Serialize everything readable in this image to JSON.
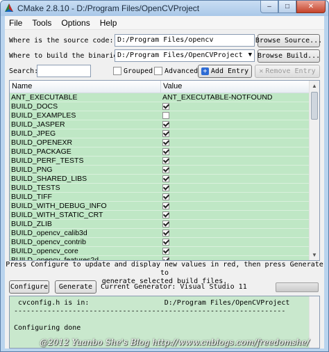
{
  "window": {
    "title": "CMake 2.8.10 - D:/Program Files/OpenCVProject",
    "controls": {
      "minimize": "–",
      "maximize": "□",
      "close": "✕"
    }
  },
  "menu": [
    "File",
    "Tools",
    "Options",
    "Help"
  ],
  "source": {
    "label": "Where is the source code:",
    "value": "D:/Program Files/opencv",
    "browse": "Browse Source..."
  },
  "binaries": {
    "label": "Where to build the binaries:",
    "value": "D:/Program Files/OpenCVProject",
    "browse": "Browse Build..."
  },
  "search": {
    "label": "Search:",
    "value": "",
    "grouped": "Grouped",
    "grouped_checked": false,
    "advanced": "Advanced",
    "advanced_checked": false,
    "add_entry": "Add Entry",
    "remove_entry": "Remove Entry"
  },
  "table": {
    "headers": {
      "name": "Name",
      "value": "Value"
    },
    "rows": [
      {
        "name": "ANT_EXECUTABLE",
        "type": "text",
        "value": "ANT_EXECUTABLE-NOTFOUND"
      },
      {
        "name": "BUILD_DOCS",
        "type": "bool",
        "checked": true
      },
      {
        "name": "BUILD_EXAMPLES",
        "type": "bool",
        "checked": false
      },
      {
        "name": "BUILD_JASPER",
        "type": "bool",
        "checked": true
      },
      {
        "name": "BUILD_JPEG",
        "type": "bool",
        "checked": true
      },
      {
        "name": "BUILD_OPENEXR",
        "type": "bool",
        "checked": true
      },
      {
        "name": "BUILD_PACKAGE",
        "type": "bool",
        "checked": true
      },
      {
        "name": "BUILD_PERF_TESTS",
        "type": "bool",
        "checked": true
      },
      {
        "name": "BUILD_PNG",
        "type": "bool",
        "checked": true
      },
      {
        "name": "BUILD_SHARED_LIBS",
        "type": "bool",
        "checked": true
      },
      {
        "name": "BUILD_TESTS",
        "type": "bool",
        "checked": true
      },
      {
        "name": "BUILD_TIFF",
        "type": "bool",
        "checked": true
      },
      {
        "name": "BUILD_WITH_DEBUG_INFO",
        "type": "bool",
        "checked": true
      },
      {
        "name": "BUILD_WITH_STATIC_CRT",
        "type": "bool",
        "checked": true
      },
      {
        "name": "BUILD_ZLIB",
        "type": "bool",
        "checked": true
      },
      {
        "name": "BUILD_opencv_calib3d",
        "type": "bool",
        "checked": true
      },
      {
        "name": "BUILD_opencv_contrib",
        "type": "bool",
        "checked": true
      },
      {
        "name": "BUILD_opencv_core",
        "type": "bool",
        "checked": true
      },
      {
        "name": "BUILD_opencv_features2d",
        "type": "bool",
        "checked": true
      }
    ]
  },
  "info": {
    "line1": "Press Configure to update and display new values in red, then press Generate to",
    "line2": "generate selected build files."
  },
  "actions": {
    "configure": "Configure",
    "generate": "Generate",
    "current_generator": "Current Generator: Visual Studio 11"
  },
  "output": {
    "lines": [
      " cvconfig.h is in:                  D:/Program Files/OpenCVProject",
      "-----------------------------------------------------------------",
      "",
      "Configuring done"
    ]
  },
  "watermark": "@2012 Yuanbo She's Blog http://www.cnblogs.com/freedomshe/",
  "colors": {
    "row_bg": "#bfe7c5",
    "output_bg": "#c9e8cd",
    "frame": "#b9d4ee"
  }
}
